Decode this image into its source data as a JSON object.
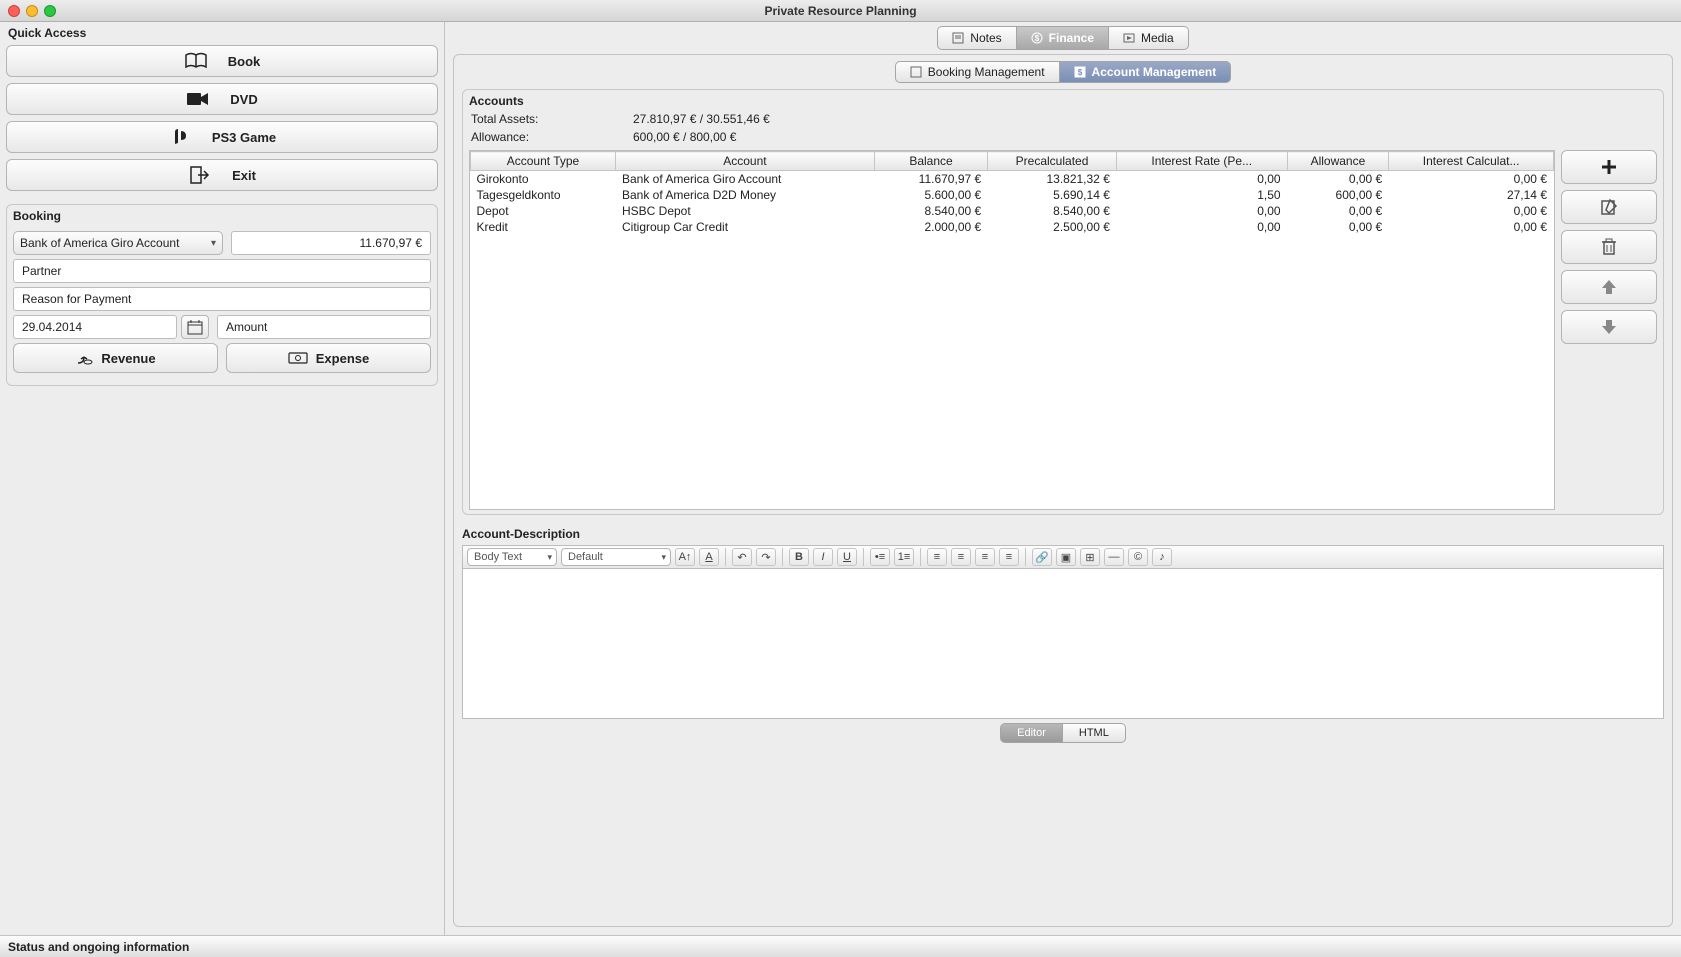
{
  "window": {
    "title": "Private Resource Planning"
  },
  "quick_access": {
    "label": "Quick Access",
    "book": "Book",
    "dvd": "DVD",
    "ps3": "PS3 Game",
    "exit": "Exit"
  },
  "booking": {
    "label": "Booking",
    "account_selected": "Bank of America Giro Account",
    "balance": "11.670,97 €",
    "partner_ph": "Partner",
    "reason_ph": "Reason for Payment",
    "date": "29.04.2014",
    "amount_ph": "Amount",
    "revenue": "Revenue",
    "expense": "Expense"
  },
  "top_tabs": {
    "notes": "Notes",
    "finance": "Finance",
    "media": "Media"
  },
  "sub_tabs": {
    "booking_mgmt": "Booking Management",
    "account_mgmt": "Account Management"
  },
  "accounts": {
    "section_label": "Accounts",
    "total_assets_label": "Total Assets:",
    "total_assets_value": "27.810,97 €  /  30.551,46 €",
    "allowance_label": "Allowance:",
    "allowance_value": "600,00 €  /  800,00 €",
    "headers": {
      "type": "Account Type",
      "account": "Account",
      "balance": "Balance",
      "precalc": "Precalculated",
      "rate": "Interest Rate (Pe...",
      "allowance": "Allowance",
      "intcalc": "Interest Calculat..."
    },
    "rows": [
      {
        "type": "Girokonto",
        "account": "Bank of America Giro Account",
        "balance": "11.670,97 €",
        "precalc": "13.821,32 €",
        "rate": "0,00",
        "allowance": "0,00 €",
        "intcalc": "0,00 €"
      },
      {
        "type": "Tagesgeldkonto",
        "account": "Bank of America D2D Money",
        "balance": "5.600,00 €",
        "precalc": "5.690,14 €",
        "rate": "1,50",
        "allowance": "600,00 €",
        "intcalc": "27,14 €"
      },
      {
        "type": "Depot",
        "account": "HSBC Depot",
        "balance": "8.540,00 €",
        "precalc": "8.540,00 €",
        "rate": "0,00",
        "allowance": "0,00 €",
        "intcalc": "0,00 €"
      },
      {
        "type": "Kredit",
        "account": "Citigroup Car Credit",
        "balance": "2.000,00 €",
        "precalc": "2.500,00 €",
        "rate": "0,00",
        "allowance": "0,00 €",
        "intcalc": "0,00 €"
      }
    ]
  },
  "description": {
    "label": "Account-Description",
    "style": "Body Text",
    "font": "Default",
    "editor_tab": "Editor",
    "html_tab": "HTML"
  },
  "status": "Status and ongoing information"
}
